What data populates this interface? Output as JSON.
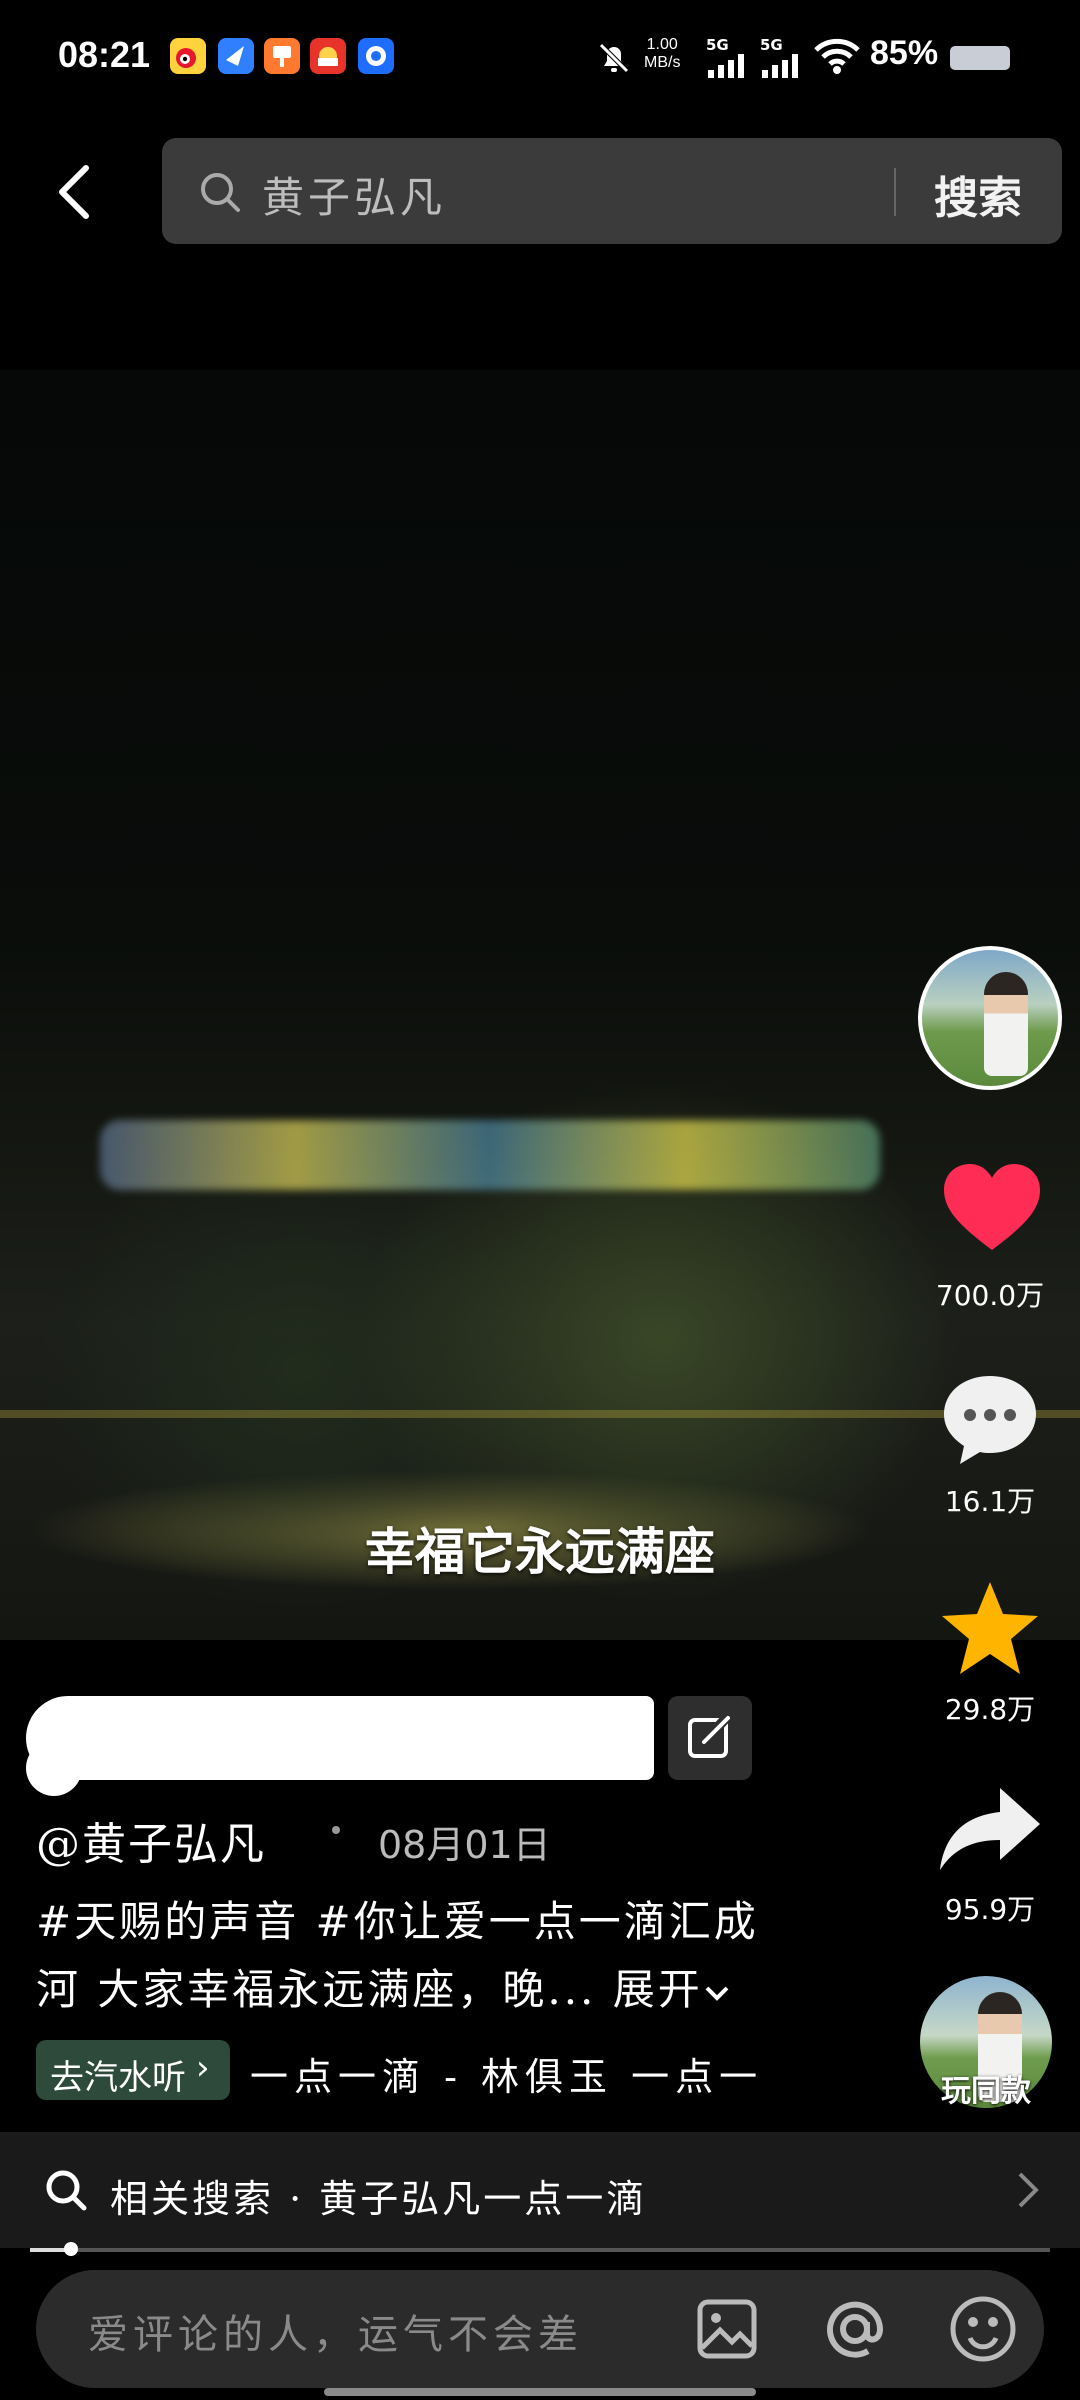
{
  "status_bar": {
    "time": "08:21",
    "net_speed_value": "1.00",
    "net_speed_unit": "MB/s",
    "sim1": "5G",
    "sim2": "5G",
    "battery": "85%"
  },
  "search": {
    "query": "黄子弘凡",
    "button_label": "搜索"
  },
  "video": {
    "subtitle": "幸福它永远满座"
  },
  "actions": {
    "likes": "700.0万",
    "comments": "16.1万",
    "favorites": "29.8万",
    "shares": "95.9万",
    "play_same_label": "玩同款"
  },
  "post": {
    "author": "@黄子弘凡",
    "date": "08月01日",
    "description_line1": "#天赐的声音 #你让爱一点一滴汇成",
    "description_line2": "河 大家幸福永远满座，晚...",
    "expand_label": "展开",
    "music_chip_label": "去汽水听",
    "music_title": "一点一滴 - 林俱玉    一点一"
  },
  "related": {
    "text": "相关搜索 · 黄子弘凡一点一滴"
  },
  "progress": {
    "fraction": 0.04
  },
  "comment": {
    "placeholder": "爱评论的人，运气不会差"
  },
  "colors": {
    "like": "#ff2d55",
    "favorite": "#ffb400",
    "music_chip": "#2d4a3a"
  }
}
